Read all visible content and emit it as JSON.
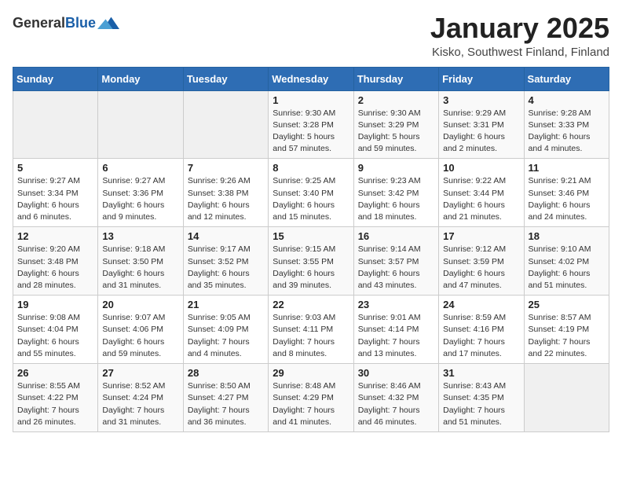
{
  "header": {
    "logo_general": "General",
    "logo_blue": "Blue",
    "month_title": "January 2025",
    "location": "Kisko, Southwest Finland, Finland"
  },
  "weekdays": [
    "Sunday",
    "Monday",
    "Tuesday",
    "Wednesday",
    "Thursday",
    "Friday",
    "Saturday"
  ],
  "weeks": [
    [
      {
        "day": "",
        "info": ""
      },
      {
        "day": "",
        "info": ""
      },
      {
        "day": "",
        "info": ""
      },
      {
        "day": "1",
        "info": "Sunrise: 9:30 AM\nSunset: 3:28 PM\nDaylight: 5 hours\nand 57 minutes."
      },
      {
        "day": "2",
        "info": "Sunrise: 9:30 AM\nSunset: 3:29 PM\nDaylight: 5 hours\nand 59 minutes."
      },
      {
        "day": "3",
        "info": "Sunrise: 9:29 AM\nSunset: 3:31 PM\nDaylight: 6 hours\nand 2 minutes."
      },
      {
        "day": "4",
        "info": "Sunrise: 9:28 AM\nSunset: 3:33 PM\nDaylight: 6 hours\nand 4 minutes."
      }
    ],
    [
      {
        "day": "5",
        "info": "Sunrise: 9:27 AM\nSunset: 3:34 PM\nDaylight: 6 hours\nand 6 minutes."
      },
      {
        "day": "6",
        "info": "Sunrise: 9:27 AM\nSunset: 3:36 PM\nDaylight: 6 hours\nand 9 minutes."
      },
      {
        "day": "7",
        "info": "Sunrise: 9:26 AM\nSunset: 3:38 PM\nDaylight: 6 hours\nand 12 minutes."
      },
      {
        "day": "8",
        "info": "Sunrise: 9:25 AM\nSunset: 3:40 PM\nDaylight: 6 hours\nand 15 minutes."
      },
      {
        "day": "9",
        "info": "Sunrise: 9:23 AM\nSunset: 3:42 PM\nDaylight: 6 hours\nand 18 minutes."
      },
      {
        "day": "10",
        "info": "Sunrise: 9:22 AM\nSunset: 3:44 PM\nDaylight: 6 hours\nand 21 minutes."
      },
      {
        "day": "11",
        "info": "Sunrise: 9:21 AM\nSunset: 3:46 PM\nDaylight: 6 hours\nand 24 minutes."
      }
    ],
    [
      {
        "day": "12",
        "info": "Sunrise: 9:20 AM\nSunset: 3:48 PM\nDaylight: 6 hours\nand 28 minutes."
      },
      {
        "day": "13",
        "info": "Sunrise: 9:18 AM\nSunset: 3:50 PM\nDaylight: 6 hours\nand 31 minutes."
      },
      {
        "day": "14",
        "info": "Sunrise: 9:17 AM\nSunset: 3:52 PM\nDaylight: 6 hours\nand 35 minutes."
      },
      {
        "day": "15",
        "info": "Sunrise: 9:15 AM\nSunset: 3:55 PM\nDaylight: 6 hours\nand 39 minutes."
      },
      {
        "day": "16",
        "info": "Sunrise: 9:14 AM\nSunset: 3:57 PM\nDaylight: 6 hours\nand 43 minutes."
      },
      {
        "day": "17",
        "info": "Sunrise: 9:12 AM\nSunset: 3:59 PM\nDaylight: 6 hours\nand 47 minutes."
      },
      {
        "day": "18",
        "info": "Sunrise: 9:10 AM\nSunset: 4:02 PM\nDaylight: 6 hours\nand 51 minutes."
      }
    ],
    [
      {
        "day": "19",
        "info": "Sunrise: 9:08 AM\nSunset: 4:04 PM\nDaylight: 6 hours\nand 55 minutes."
      },
      {
        "day": "20",
        "info": "Sunrise: 9:07 AM\nSunset: 4:06 PM\nDaylight: 6 hours\nand 59 minutes."
      },
      {
        "day": "21",
        "info": "Sunrise: 9:05 AM\nSunset: 4:09 PM\nDaylight: 7 hours\nand 4 minutes."
      },
      {
        "day": "22",
        "info": "Sunrise: 9:03 AM\nSunset: 4:11 PM\nDaylight: 7 hours\nand 8 minutes."
      },
      {
        "day": "23",
        "info": "Sunrise: 9:01 AM\nSunset: 4:14 PM\nDaylight: 7 hours\nand 13 minutes."
      },
      {
        "day": "24",
        "info": "Sunrise: 8:59 AM\nSunset: 4:16 PM\nDaylight: 7 hours\nand 17 minutes."
      },
      {
        "day": "25",
        "info": "Sunrise: 8:57 AM\nSunset: 4:19 PM\nDaylight: 7 hours\nand 22 minutes."
      }
    ],
    [
      {
        "day": "26",
        "info": "Sunrise: 8:55 AM\nSunset: 4:22 PM\nDaylight: 7 hours\nand 26 minutes."
      },
      {
        "day": "27",
        "info": "Sunrise: 8:52 AM\nSunset: 4:24 PM\nDaylight: 7 hours\nand 31 minutes."
      },
      {
        "day": "28",
        "info": "Sunrise: 8:50 AM\nSunset: 4:27 PM\nDaylight: 7 hours\nand 36 minutes."
      },
      {
        "day": "29",
        "info": "Sunrise: 8:48 AM\nSunset: 4:29 PM\nDaylight: 7 hours\nand 41 minutes."
      },
      {
        "day": "30",
        "info": "Sunrise: 8:46 AM\nSunset: 4:32 PM\nDaylight: 7 hours\nand 46 minutes."
      },
      {
        "day": "31",
        "info": "Sunrise: 8:43 AM\nSunset: 4:35 PM\nDaylight: 7 hours\nand 51 minutes."
      },
      {
        "day": "",
        "info": ""
      }
    ]
  ]
}
